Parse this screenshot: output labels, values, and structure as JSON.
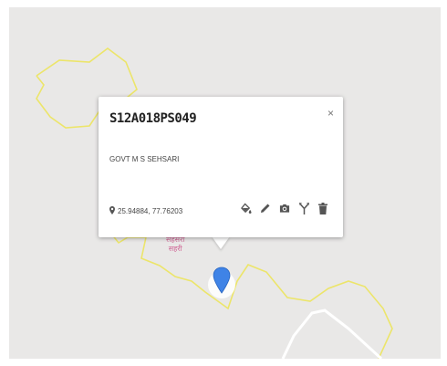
{
  "popup": {
    "title": "S12A018PS049",
    "subtitle": "GOVT M S SEHSARI",
    "coordinates": "25.94884, 77.76203",
    "close_label": "×"
  },
  "map": {
    "place_label_line1": "सेहसरी",
    "place_label_line2": "सहरी"
  },
  "icons": {
    "location": "map-pin-icon",
    "actions": [
      "paint-bucket-icon",
      "pencil-icon",
      "camera-icon",
      "directions-fork-icon",
      "trash-icon"
    ]
  },
  "colors": {
    "boundary": "#ece56a",
    "road": "#ffffff",
    "marker": "#3f83e6",
    "label": "#d06a98",
    "map_bg": "#e9e8e7"
  }
}
